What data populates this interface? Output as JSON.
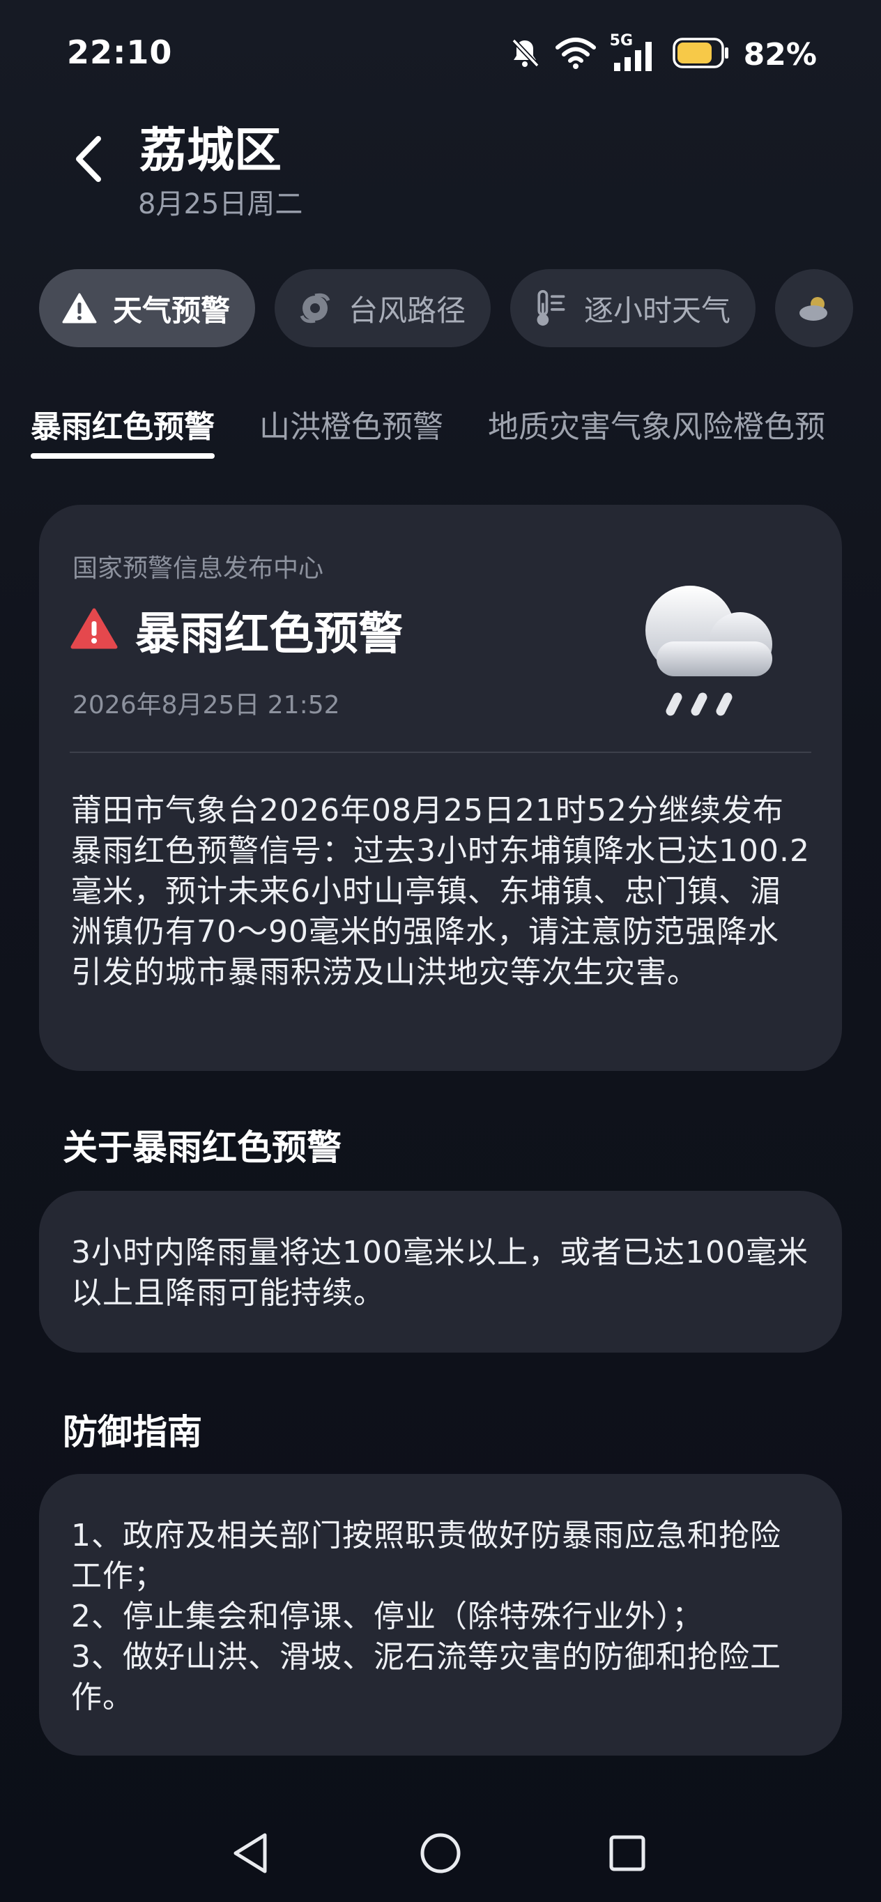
{
  "status_bar": {
    "time": "22:10",
    "network": "5G",
    "battery_percent": "82%",
    "battery_level": 0.82,
    "battery_color": "#f7c948"
  },
  "header": {
    "title": "荔城区",
    "date": "8月25日周二"
  },
  "chips": [
    {
      "label": "天气预警",
      "icon": "warning-icon",
      "active": true
    },
    {
      "label": "台风路径",
      "icon": "typhoon-icon",
      "active": false
    },
    {
      "label": "逐小时天气",
      "icon": "thermometer-icon",
      "active": false
    },
    {
      "label": "",
      "icon": "cloud-icon",
      "active": false
    }
  ],
  "tabs": [
    {
      "label": "暴雨红色预警",
      "active": true
    },
    {
      "label": "山洪橙色预警",
      "active": false
    },
    {
      "label": "地质灾害气象风险橙色预",
      "active": false
    }
  ],
  "alert": {
    "source": "国家预警信息发布中心",
    "title": "暴雨红色预警",
    "time": "2026年8月25日 21:52",
    "icon": "warning-red-icon",
    "icon_color": "#e5484d",
    "weather_icon": "rain-cloud-icon",
    "description": "莆田市气象台2026年08月25日21时52分继续发布暴雨红色预警信号：过去3小时东埔镇降水已达100.2毫米，预计未来6小时山亭镇、东埔镇、忠门镇、湄洲镇仍有70～90毫米的强降水，请注意防范强降水引发的城市暴雨积涝及山洪地灾等次生灾害。"
  },
  "about": {
    "title": "关于暴雨红色预警",
    "text": "3小时内降雨量将达100毫米以上，或者已达100毫米以上且降雨可能持续。"
  },
  "guide": {
    "title": "防御指南",
    "text": "1、政府及相关部门按照职责做好防暴雨应急和抢险工作；\n2、停止集会和停课、停业（除特殊行业外）；\n3、做好山洪、滑坡、泥石流等灾害的防御和抢险工作。"
  },
  "nav": {
    "back": "nav-back-icon",
    "home": "nav-home-icon",
    "recents": "nav-recents-icon"
  }
}
